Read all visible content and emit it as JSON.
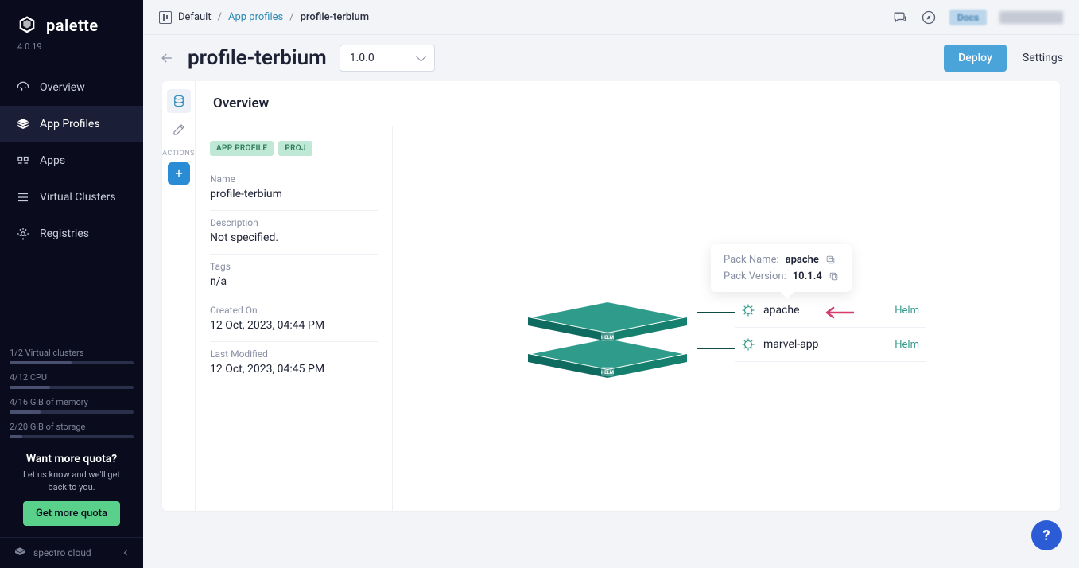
{
  "brand": {
    "name": "palette",
    "version": "4.0.19",
    "footer": "spectro cloud"
  },
  "sidebar": {
    "items": [
      {
        "label": "Overview"
      },
      {
        "label": "App Profiles"
      },
      {
        "label": "Apps"
      },
      {
        "label": "Virtual Clusters"
      },
      {
        "label": "Registries"
      }
    ],
    "quota": [
      {
        "label": "1/2 Virtual clusters",
        "pct": 50
      },
      {
        "label": "4/12 CPU",
        "pct": 33
      },
      {
        "label": "4/16 GiB of memory",
        "pct": 25
      },
      {
        "label": "2/20 GiB of storage",
        "pct": 10
      }
    ],
    "cta": {
      "title": "Want more quota?",
      "sub": "Let us know and we'll get back to you.",
      "button": "Get more quota"
    }
  },
  "breadcrumb": {
    "project_label": "Default",
    "link": "App profiles",
    "current": "profile-terbium"
  },
  "topbar": {
    "docs_label": "Docs"
  },
  "header": {
    "title": "profile-terbium",
    "version": "1.0.0",
    "deploy": "Deploy",
    "settings": "Settings"
  },
  "rail": {
    "actions_label": "ACTIONS"
  },
  "overview": {
    "title": "Overview",
    "tags": [
      "APP PROFILE",
      "PROJ"
    ],
    "fields": [
      {
        "label": "Name",
        "value": "profile-terbium"
      },
      {
        "label": "Description",
        "value": "Not specified."
      },
      {
        "label": "Tags",
        "value": "n/a"
      },
      {
        "label": "Created On",
        "value": "12 Oct, 2023, 04:44 PM"
      },
      {
        "label": "Last Modified",
        "value": "12 Oct, 2023, 04:45 PM"
      }
    ]
  },
  "layers": [
    {
      "name": "apache",
      "type": "Helm"
    },
    {
      "name": "marvel-app",
      "type": "Helm"
    }
  ],
  "tooltip": {
    "pack_name_label": "Pack Name:",
    "pack_name_value": "apache",
    "pack_version_label": "Pack Version:",
    "pack_version_value": "10.1.4"
  },
  "colors": {
    "teal": "#2f9b8a",
    "teal_dark": "#0f6b5f"
  }
}
